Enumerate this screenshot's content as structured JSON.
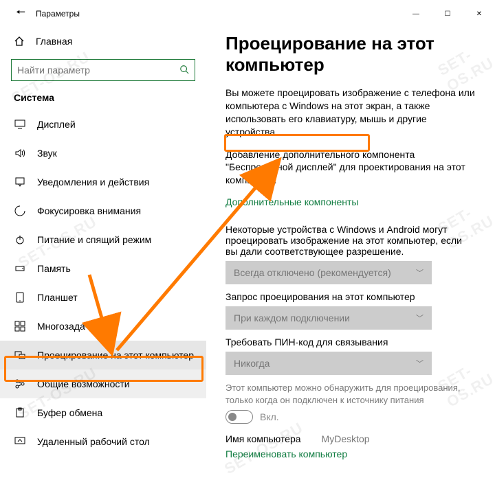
{
  "window": {
    "title": "Параметры",
    "minimize": "—",
    "maximize": "☐",
    "close": "✕"
  },
  "sidebar": {
    "home": "Главная",
    "search_placeholder": "Найти параметр",
    "section": "Система",
    "items": [
      {
        "label": "Дисплей"
      },
      {
        "label": "Звук"
      },
      {
        "label": "Уведомления и действия"
      },
      {
        "label": "Фокусировка внимания"
      },
      {
        "label": "Питание и спящий режим"
      },
      {
        "label": "Память"
      },
      {
        "label": "Планшет"
      },
      {
        "label": "Многозадачность"
      },
      {
        "label": "Проецирование на этот компьютер"
      },
      {
        "label": "Общие возможности"
      },
      {
        "label": "Буфер обмена"
      },
      {
        "label": "Удаленный рабочий стол"
      }
    ]
  },
  "main": {
    "heading": "Проецирование на этот компьютер",
    "intro": "Вы можете проецировать изображение с телефона или компьютера с Windows на этот экран, а также использовать его клавиатуру, мышь и другие устройства.",
    "add_component": "Добавление дополнительного компонента \"Беспроводной дисплей\" для проектирования на этот компьютер:",
    "link": "Дополнительные компоненты",
    "s1_label": "Некоторые устройства с Windows и Android могут проецировать изображение на этот компьютер, если вы дали соответствующее разрешение.",
    "s1_value": "Всегда отключено (рекомендуется)",
    "s2_label": "Запрос проецирования на этот компьютер",
    "s2_value": "При каждом подключении",
    "s3_label": "Требовать ПИН-код для связывания",
    "s3_value": "Никогда",
    "discover_note": "Этот компьютер можно обнаружить для проецирования, только когда он подключен к источнику питания",
    "toggle_label": "Вкл.",
    "pc_name_label": "Имя компьютера",
    "pc_name_value": "MyDesktop",
    "rename_link": "Переименовать компьютер"
  },
  "watermark": "SET-OS.RU"
}
